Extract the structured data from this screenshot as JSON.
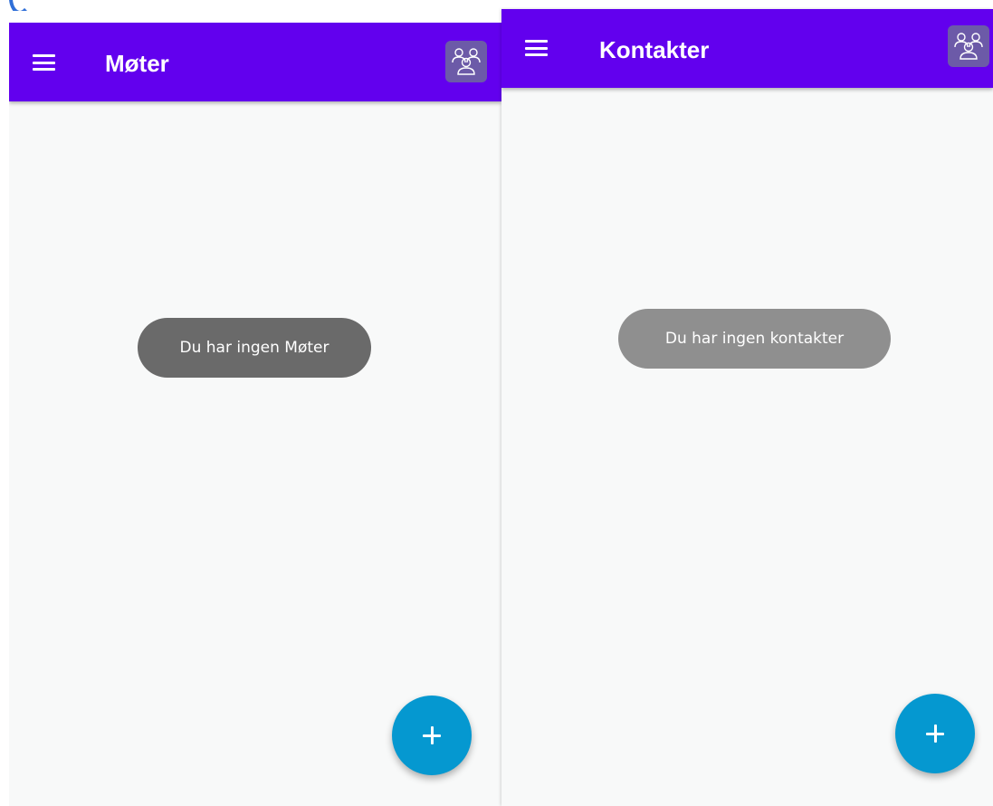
{
  "colors": {
    "app_bar": "#6200ee",
    "background": "#f8f9f9",
    "fab": "#0598d0",
    "toast_left": "#6a6a6a",
    "toast_right": "#8f8f8f"
  },
  "screens": [
    {
      "title": "Møter",
      "empty_message": "Du har ingen Møter",
      "icons": {
        "menu": "hamburger-menu-icon",
        "group": "group-people-icon",
        "fab": "plus-icon"
      }
    },
    {
      "title": "Kontakter",
      "empty_message": "Du har ingen kontakter",
      "icons": {
        "menu": "hamburger-menu-icon",
        "group": "group-people-icon",
        "fab": "plus-icon"
      }
    }
  ]
}
